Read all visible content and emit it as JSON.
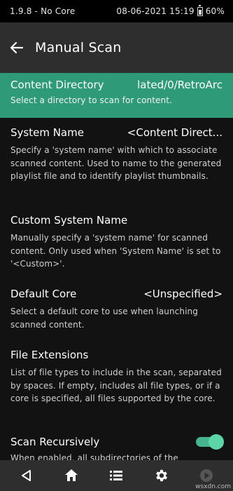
{
  "status_bar": {
    "version_text": "1.9.8 - No Core",
    "datetime": "08-06-2021 15:19",
    "battery_text": "60%",
    "battery_level": 0.6
  },
  "app_bar": {
    "title": "Manual Scan",
    "back_icon": "arrow-left-icon"
  },
  "settings": [
    {
      "title": "Content Directory",
      "value": "lated/0/RetroArc",
      "description": "Select a directory to scan for content.",
      "selected": true
    },
    {
      "title": "System Name",
      "value": "<Content Direct...",
      "description": "Specify a 'system name' with which to associate scanned content. Used to name to the generated playlist file and to identify playlist thumbnails."
    },
    {
      "title": "Custom System Name",
      "value": "",
      "description": "Manually specify a 'system name' for scanned content. Only used when 'System Name' is set to '<Custom>'."
    },
    {
      "title": "Default Core",
      "value": "<Unspecified>",
      "description": "Select a default core to use when launching scanned content."
    },
    {
      "title": "File Extensions",
      "value": "",
      "description": "List of file types to include in the scan, separated by spaces. If empty, includes all file types, or if a core is specified, all files supported by the core."
    },
    {
      "title": "Scan Recursively",
      "value": "",
      "description": "When enabled, all subdirectories of the",
      "toggle_on": true
    }
  ],
  "nav_bar": {
    "items": [
      "back-triangle-icon",
      "home-icon",
      "list-icon",
      "gear-icon",
      "play-circle-icon"
    ]
  },
  "watermark": "wsxdn.com",
  "colors": {
    "selected_bg": "#2e9a78",
    "toggle_on": "#5cd6a8",
    "app_bar_bg": "#2e2e2e",
    "background": "#121212"
  }
}
